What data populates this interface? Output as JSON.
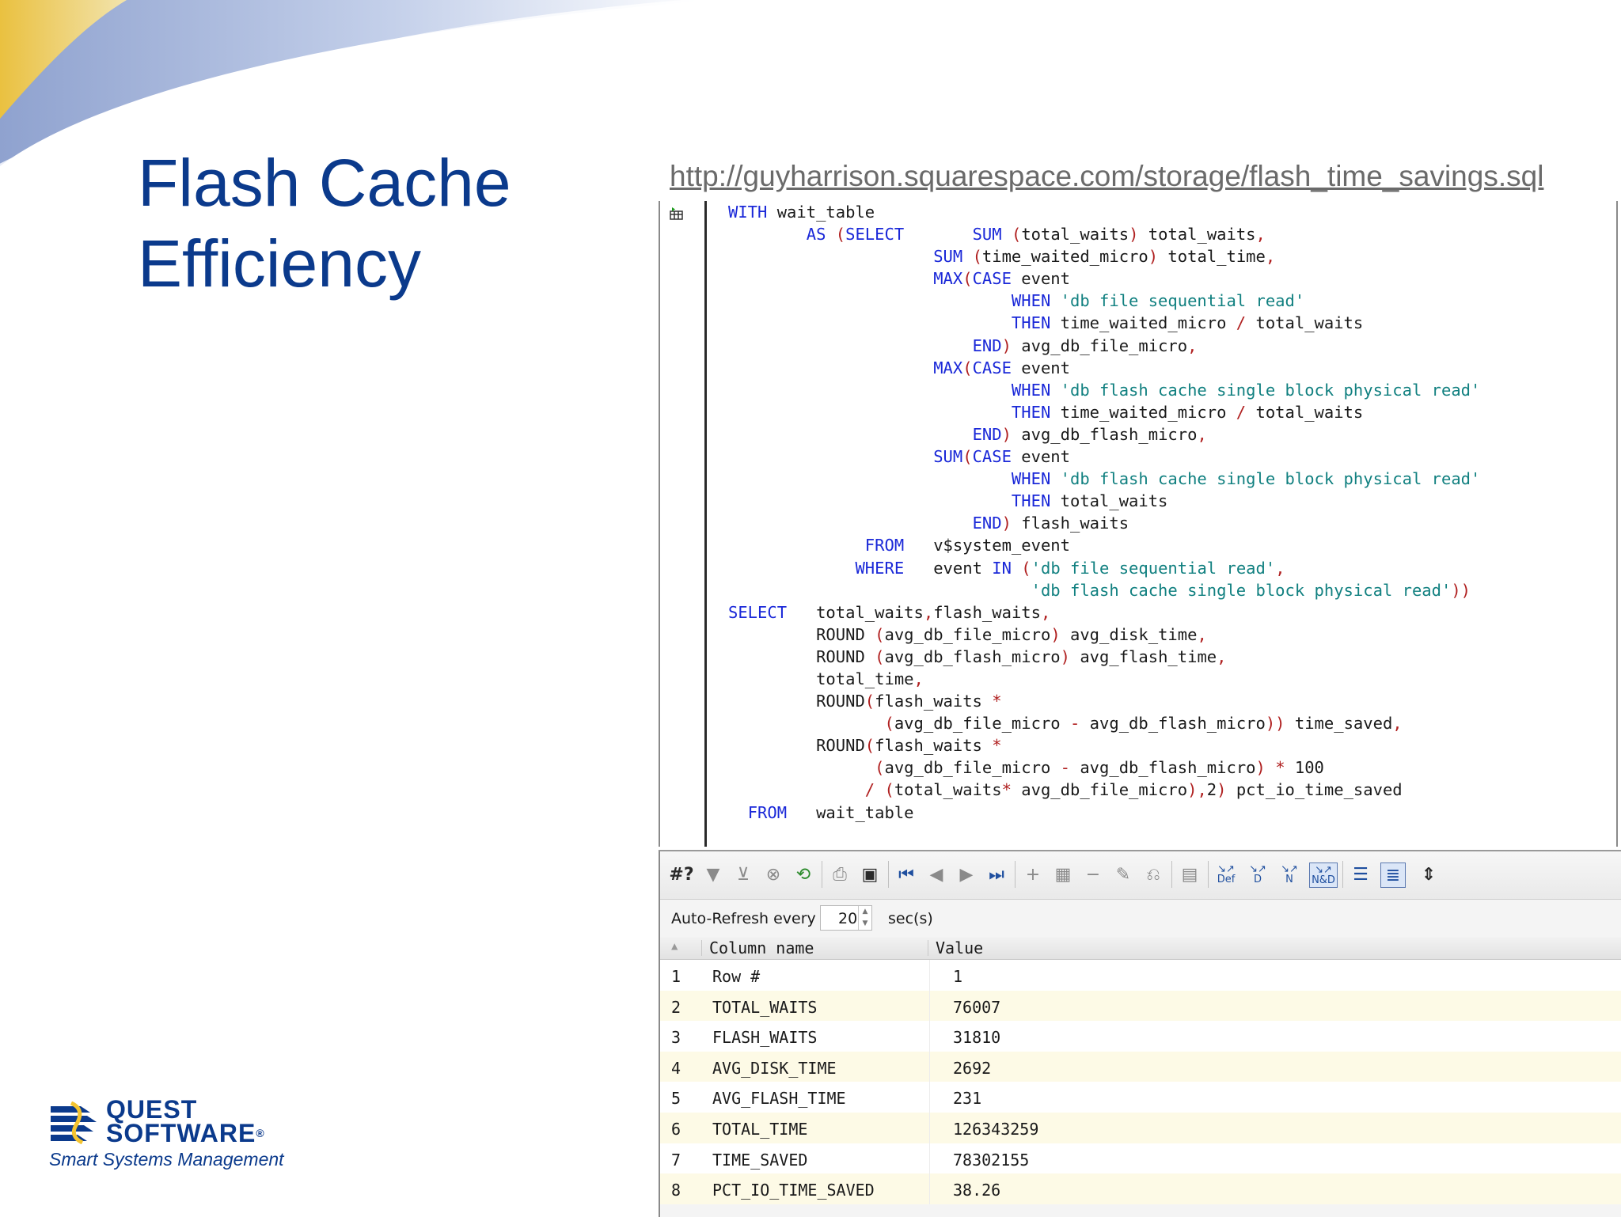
{
  "slide": {
    "title_line1": "Flash Cache",
    "title_line2": "Efficiency",
    "url": "http://guyharrison.squarespace.com/storage/flash_time_savings.sql"
  },
  "editor": {
    "run_icon": "execute-icon"
  },
  "toolbar": {
    "query_label": "#?",
    "icons": [
      "filter-icon",
      "filter-clear-icon",
      "stop-icon",
      "refresh-icon",
      "print-icon",
      "save-icon",
      "first-record-icon",
      "prior-record-icon",
      "next-record-icon",
      "last-record-icon",
      "insert-record-icon",
      "grid-icon",
      "delete-record-icon",
      "post-edit-icon",
      "cancel-edit-icon",
      "column-select-icon",
      "def-icon",
      "d-icon",
      "n-icon",
      "nd-icon",
      "grid-view-icon",
      "single-record-view-icon",
      "fit-columns-icon"
    ],
    "def_label": "Def",
    "d_label": "D",
    "n_label": "N",
    "nd_label": "N&D"
  },
  "auto_refresh": {
    "label": "Auto-Refresh every",
    "value": "20",
    "unit": "sec(s)"
  },
  "result_grid": {
    "col_name_header": "Column name",
    "value_header": "Value",
    "rows": [
      {
        "n": "1",
        "name": "Row #",
        "value": "1"
      },
      {
        "n": "2",
        "name": "TOTAL_WAITS",
        "value": "76007"
      },
      {
        "n": "3",
        "name": "FLASH_WAITS",
        "value": "31810"
      },
      {
        "n": "4",
        "name": "AVG_DISK_TIME",
        "value": "2692"
      },
      {
        "n": "5",
        "name": "AVG_FLASH_TIME",
        "value": "231"
      },
      {
        "n": "6",
        "name": "TOTAL_TIME",
        "value": "126343259"
      },
      {
        "n": "7",
        "name": "TIME_SAVED",
        "value": "78302155"
      },
      {
        "n": "8",
        "name": "PCT_IO_TIME_SAVED",
        "value": "38.26"
      }
    ]
  },
  "logo": {
    "line1": "QUEST",
    "line2": "SOFTWARE",
    "reg": "®",
    "tagline": "Smart Systems Management"
  },
  "colors": {
    "title": "#0b3a8c",
    "keyword": "#1a28d8",
    "string": "#118080",
    "punct": "#b02020",
    "alt_row": "#fdfae6"
  }
}
